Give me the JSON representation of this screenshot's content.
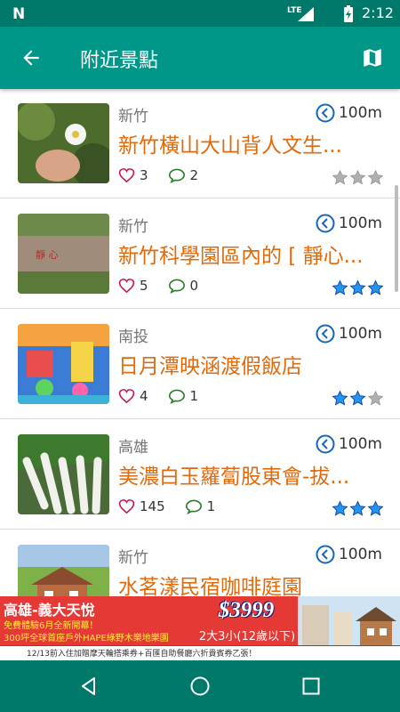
{
  "status_bar": {
    "time": "2:12",
    "network": "LTE",
    "notification_icon": "N"
  },
  "app_bar": {
    "title": "附近景點",
    "back_icon": "arrow-back-icon",
    "map_icon": "map-icon"
  },
  "places": [
    {
      "region": "新竹",
      "distance": "100m",
      "name": "新竹橫山大山背人文生...",
      "likes": "3",
      "comments": "2",
      "rating": 0
    },
    {
      "region": "新竹",
      "distance": "100m",
      "name": "新竹科學園區內的 [ 靜心...",
      "likes": "5",
      "comments": "0",
      "rating": 3
    },
    {
      "region": "南投",
      "distance": "100m",
      "name": "日月潭映涵渡假飯店",
      "likes": "4",
      "comments": "1",
      "rating": 2
    },
    {
      "region": "高雄",
      "distance": "100m",
      "name": "美濃白玉蘿蔔股東會-拔...",
      "likes": "145",
      "comments": "1",
      "rating": 3
    },
    {
      "region": "新竹",
      "distance": "100m",
      "name": "水茗漾民宿咖啡庭園",
      "likes": "",
      "comments": "",
      "rating": 0
    }
  ],
  "ad": {
    "headline": "高雄-義大天悅",
    "line1": "免費體驗6月全新開幕！",
    "line2": "300坪全球首座戶外HAPE綠野木樂地樂園",
    "price": "$3999",
    "price_sub": "2大3小(12歲以下)",
    "footer": "12/13前入住加贈摩天輪搭乘券+百匯自助餐廳六折貴賓券乙張！"
  },
  "colors": {
    "primary": "#009688",
    "primary_dark": "#00796b",
    "title_orange": "#e06a0c",
    "star_blue": "#1976d2",
    "star_grey": "#b0b0b0"
  }
}
